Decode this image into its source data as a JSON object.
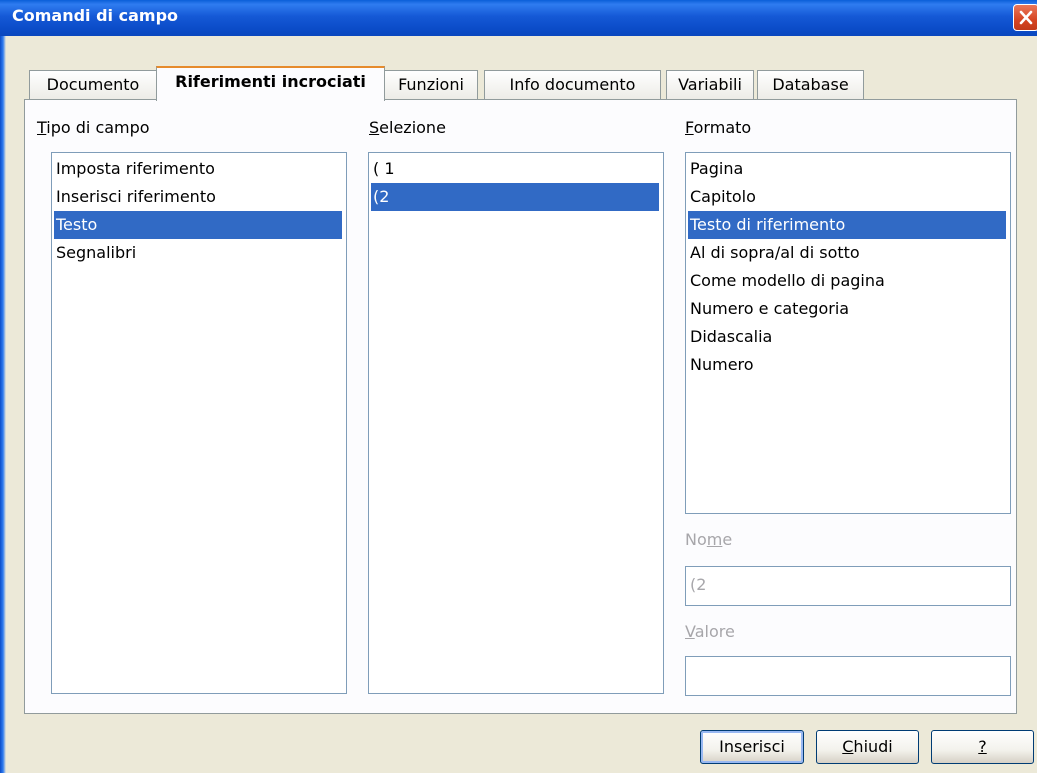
{
  "window": {
    "title": "Comandi di campo"
  },
  "tabs": [
    {
      "label": "Documento"
    },
    {
      "label": "Riferimenti incrociati"
    },
    {
      "label": "Funzioni"
    },
    {
      "label": "Info documento"
    },
    {
      "label": "Variabili"
    },
    {
      "label": "Database"
    }
  ],
  "field_type": {
    "label_mn": "T",
    "label_rest": "ipo di campo",
    "items": [
      "Imposta riferimento",
      "Inserisci riferimento",
      "Testo",
      "Segnalibri"
    ],
    "selected": "Testo"
  },
  "selection": {
    "label_mn": "S",
    "label_rest": "elezione",
    "items": [
      "( 1",
      "(2"
    ],
    "selected": "(2"
  },
  "format": {
    "label_mn": "F",
    "label_rest": "ormato",
    "items": [
      "Pagina",
      "Capitolo",
      "Testo di riferimento",
      "Al di sopra/al di sotto",
      "Come modello di pagina",
      "Numero e categoria",
      "Didascalia",
      "Numero"
    ],
    "selected": "Testo di riferimento"
  },
  "name": {
    "label_a": "No",
    "label_mn": "m",
    "label_b": "e",
    "value": "(2"
  },
  "value": {
    "label_mn": "V",
    "label_rest": "alore",
    "value": ""
  },
  "buttons": {
    "insert": "Inserisci",
    "close_mn": "C",
    "close_rest": "hiudi",
    "help": "?"
  }
}
